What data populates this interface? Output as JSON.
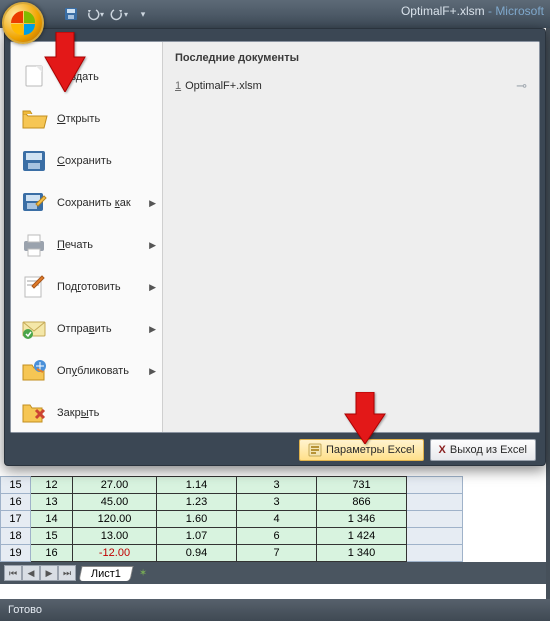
{
  "title": {
    "file": "OptimalF+.xlsm",
    "dash": " - ",
    "app": "Microsoft"
  },
  "qat": {
    "save": "save",
    "undo": "undo",
    "redo": "redo",
    "custom": "▾"
  },
  "menu": {
    "items": [
      {
        "icon": "new",
        "label": "Создать",
        "u": 3,
        "arrow": false
      },
      {
        "icon": "open",
        "label": "Открыть",
        "u": 0,
        "arrow": false
      },
      {
        "icon": "save",
        "label": "Сохранить",
        "u": 0,
        "arrow": false
      },
      {
        "icon": "saveas",
        "label": "Сохранить как",
        "u": 10,
        "arrow": true
      },
      {
        "icon": "print",
        "label": "Печать",
        "u": 0,
        "arrow": true
      },
      {
        "icon": "prep",
        "label": "Подготовить",
        "u": 3,
        "arrow": true
      },
      {
        "icon": "send",
        "label": "Отправить",
        "u": 5,
        "arrow": true
      },
      {
        "icon": "publish",
        "label": "Опубликовать",
        "u": 2,
        "arrow": true
      },
      {
        "icon": "close",
        "label": "Закрыть",
        "u": 4,
        "arrow": false
      }
    ],
    "recent_head": "Последние документы",
    "recent": [
      {
        "idx": "1",
        "name": "OptimalF+.xlsm"
      }
    ],
    "param_label": "Параметры Excel",
    "exit_label": "Выход из Excel"
  },
  "sheet": {
    "rows": [
      {
        "hdr": "15",
        "cells": [
          "12",
          "27.00",
          "1.14",
          "3",
          "731"
        ]
      },
      {
        "hdr": "16",
        "cells": [
          "13",
          "45.00",
          "1.23",
          "3",
          "866"
        ]
      },
      {
        "hdr": "17",
        "cells": [
          "14",
          "120.00",
          "1.60",
          "4",
          "1 346"
        ]
      },
      {
        "hdr": "18",
        "cells": [
          "15",
          "13.00",
          "1.07",
          "6",
          "1 424"
        ]
      },
      {
        "hdr": "19",
        "cells": [
          "16",
          "-12.00",
          "0.94",
          "7",
          "1 340"
        ]
      }
    ],
    "tab": "Лист1",
    "status": "Готово"
  }
}
